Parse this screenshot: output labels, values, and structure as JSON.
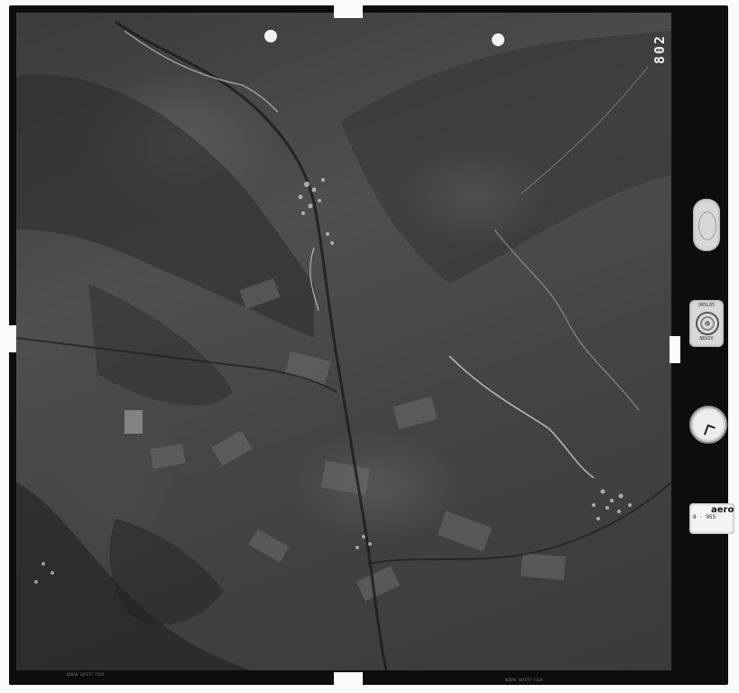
{
  "frame_number": "802",
  "brand_mark": "aerotop",
  "date_stamp": "8 · 955",
  "lens_badge": {
    "top_text": "OR5L85",
    "bottom_text": "NOGIV"
  },
  "film_edge_text": {
    "bottom_left": "KODAK SAFETY FILM",
    "bottom_right": "KODAK SAFETY FILM"
  },
  "photo": {
    "type": "aerial-photograph",
    "tone": "black-and-white",
    "features": [
      "river-valley",
      "town",
      "village",
      "roads",
      "field-parcels",
      "forest-slopes"
    ]
  }
}
